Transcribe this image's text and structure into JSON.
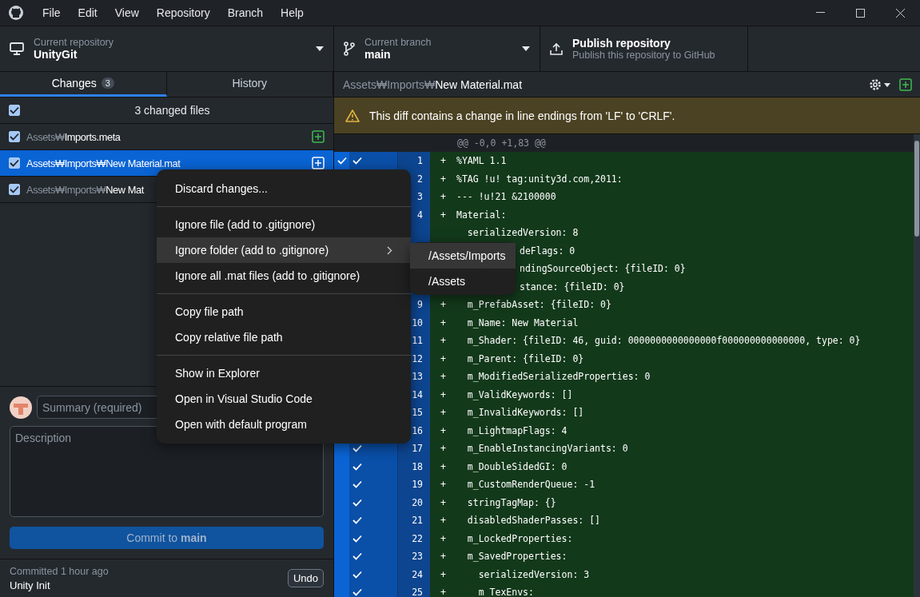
{
  "menu_bar": [
    "File",
    "Edit",
    "View",
    "Repository",
    "Branch",
    "Help"
  ],
  "toolbar": {
    "repository": {
      "label": "Current repository",
      "value": "UnityGit"
    },
    "branch": {
      "label": "Current branch",
      "value": "main"
    },
    "publish": {
      "title": "Publish repository",
      "subtitle": "Publish this repository to GitHub"
    }
  },
  "tabs": [
    {
      "label": "Changes",
      "badge": "3",
      "selected": true
    },
    {
      "label": "History",
      "selected": false
    }
  ],
  "changes": {
    "summary": "3 changed files",
    "all_checked": true,
    "files": [
      {
        "dir": "Assets₩",
        "name": "Imports.meta",
        "checked": true,
        "selected": false,
        "kind": "added"
      },
      {
        "dir": "Assets₩Imports₩",
        "name": "New Material.mat",
        "checked": true,
        "selected": true,
        "kind": "added"
      },
      {
        "dir": "Assets₩Imports₩",
        "name": "New Mat",
        "checked": true,
        "selected": false
      }
    ]
  },
  "commit": {
    "summary": {
      "placeholder": "Summary (required)"
    },
    "description": {
      "placeholder": "Description"
    },
    "button": "Commit to **main**"
  },
  "last_commit": {
    "label": "Committed 1 hour ago",
    "message": "Unity Init",
    "undo": "Undo"
  },
  "diff": {
    "path_dir": "Assets₩Imports₩",
    "path_name": "New Material.mat",
    "warning": "This diff contains a change in line endings from 'LF' to 'CRLF'.",
    "hunk": "@@ -0,0 +1,83 @@",
    "hunk_checked": true,
    "lines": [
      {
        "kind": "line",
        "num": "1",
        "sign": "+",
        "text": "%YAML 1.1",
        "checked": true
      },
      {
        "kind": "line",
        "num": "2",
        "sign": "+",
        "text": "%TAG !u! tag:unity3d.com,2011:"
      },
      {
        "kind": "line",
        "num": "3",
        "sign": "+",
        "text": "--- !u!21 &2100000"
      },
      {
        "kind": "line",
        "num": "4",
        "sign": "+",
        "text": "Material:"
      },
      {
        "kind": "line",
        "text": "  serializedVersion: 8"
      },
      {
        "kind": "partial",
        "text": "deFlags: 0"
      },
      {
        "kind": "partial",
        "text": "ndingSourceObject: {fileID: 0}"
      },
      {
        "kind": "partial",
        "text": "stance: {fileID: 0}"
      },
      {
        "kind": "line",
        "num": "9",
        "sign": "+",
        "text": "  m_PrefabAsset: {fileID: 0}"
      },
      {
        "kind": "line",
        "num": "10",
        "sign": "+",
        "text": "  m_Name: New Material"
      },
      {
        "kind": "line",
        "num": "11",
        "sign": "+",
        "text": "  m_Shader: {fileID: 46, guid: 0000000000000000f000000000000000, type: 0}"
      },
      {
        "kind": "line",
        "num": "12",
        "sign": "+",
        "text": "  m_Parent: {fileID: 0}"
      },
      {
        "kind": "line",
        "num": "13",
        "sign": "+",
        "text": "  m_ModifiedSerializedProperties: 0"
      },
      {
        "kind": "line",
        "num": "14",
        "sign": "+",
        "text": "  m_ValidKeywords: []"
      },
      {
        "kind": "line",
        "num": "15",
        "sign": "+",
        "text": "  m_InvalidKeywords: []"
      },
      {
        "kind": "line",
        "num": "16",
        "sign": "+",
        "text": "  m_LightmapFlags: 4"
      },
      {
        "kind": "line",
        "num": "17",
        "sign": "+",
        "text": "  m_EnableInstancingVariants: 0",
        "checked": true
      },
      {
        "kind": "line",
        "num": "18",
        "sign": "+",
        "text": "  m_DoubleSidedGI: 0",
        "checked": true
      },
      {
        "kind": "line",
        "num": "19",
        "sign": "+",
        "text": "  m_CustomRenderQueue: -1",
        "checked": true
      },
      {
        "kind": "line",
        "num": "20",
        "sign": "+",
        "text": "  stringTagMap: {}",
        "checked": true
      },
      {
        "kind": "line",
        "num": "21",
        "sign": "+",
        "text": "  disabledShaderPasses: []",
        "checked": true
      },
      {
        "kind": "line",
        "num": "22",
        "sign": "+",
        "text": "  m_LockedProperties:",
        "checked": true
      },
      {
        "kind": "line",
        "num": "23",
        "sign": "+",
        "text": "  m_SavedProperties:",
        "checked": true
      },
      {
        "kind": "line",
        "num": "24",
        "sign": "+",
        "text": "    serializedVersion: 3",
        "checked": true
      },
      {
        "kind": "line",
        "num": "25",
        "sign": "+",
        "text": "    m_TexEnvs:",
        "checked": true
      }
    ]
  },
  "context_menu": {
    "groups": [
      [
        {
          "label": "Discard changes...",
          "selected": false
        }
      ],
      [
        {
          "label": "Ignore file (add to .gitignore)",
          "selected": false
        },
        {
          "label": "Ignore folder (add to .gitignore)",
          "selected": true,
          "submenu": true
        },
        {
          "label": "Ignore all .mat files (add to .gitignore)",
          "selected": false
        }
      ],
      [
        {
          "label": "Copy file path",
          "selected": false
        },
        {
          "label": "Copy relative file path",
          "selected": false
        }
      ],
      [
        {
          "label": "Show in Explorer",
          "selected": false
        },
        {
          "label": "Open in Visual Studio Code",
          "selected": false
        },
        {
          "label": "Open with default program",
          "selected": false
        }
      ]
    ]
  },
  "submenu": {
    "items": [
      {
        "label": "/Assets/Imports",
        "selected": true
      },
      {
        "label": "/Assets",
        "selected": false
      }
    ]
  }
}
